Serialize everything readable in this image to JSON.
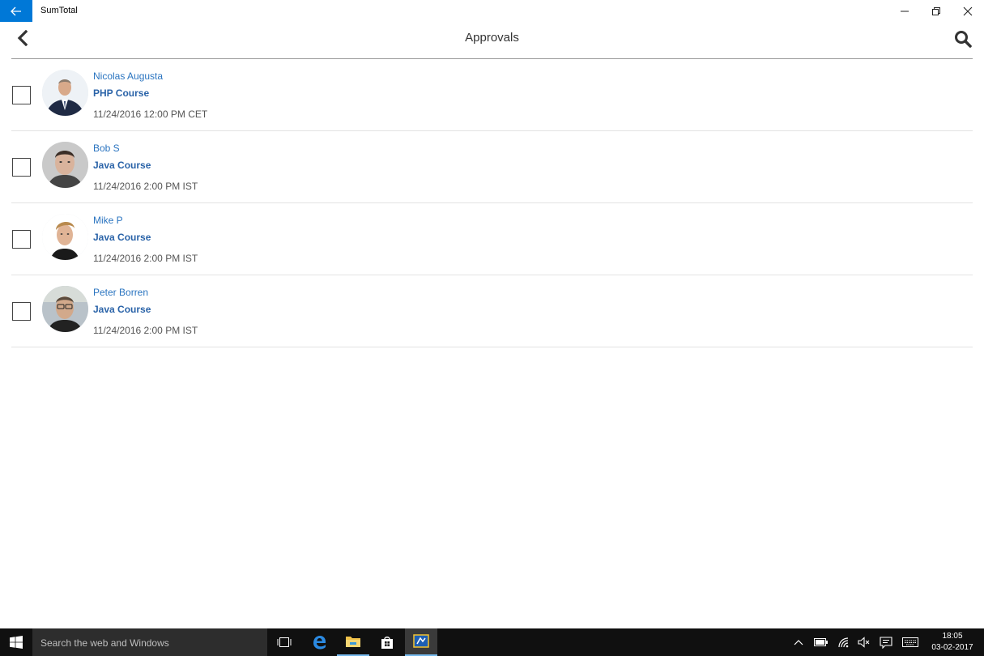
{
  "window": {
    "title": "SumTotal",
    "back_icon": "arrow-left-icon",
    "controls": [
      "minimize-icon",
      "restore-icon",
      "close-icon"
    ]
  },
  "header": {
    "title": "Approvals",
    "back_icon": "chevron-left-icon",
    "search_icon": "search-icon"
  },
  "approvals": [
    {
      "name": "Nicolas Augusta",
      "course": "PHP Course",
      "datetime": "11/24/2016 12:00 PM CET",
      "checked": false
    },
    {
      "name": "Bob S",
      "course": "Java Course",
      "datetime": "11/24/2016 2:00 PM IST",
      "checked": false
    },
    {
      "name": "Mike P",
      "course": "Java Course",
      "datetime": "11/24/2016 2:00 PM IST",
      "checked": false
    },
    {
      "name": "Peter Borren",
      "course": "Java Course",
      "datetime": "11/24/2016 2:00 PM IST",
      "checked": false
    }
  ],
  "taskbar": {
    "search_placeholder": "Search the web and Windows",
    "time": "18:05",
    "date": "03-02-2017",
    "apps": [
      "task-view-icon",
      "edge-icon",
      "file-explorer-icon",
      "store-icon",
      "sumtotal-app-icon"
    ],
    "tray": [
      "chevron-up-icon",
      "battery-icon",
      "wifi-icon",
      "volume-muted-icon",
      "notifications-icon",
      "keyboard-icon"
    ]
  },
  "colors": {
    "accent": "#0078d7",
    "link": "#2a74c0",
    "course": "#2a63a8",
    "taskbar": "#101010"
  }
}
